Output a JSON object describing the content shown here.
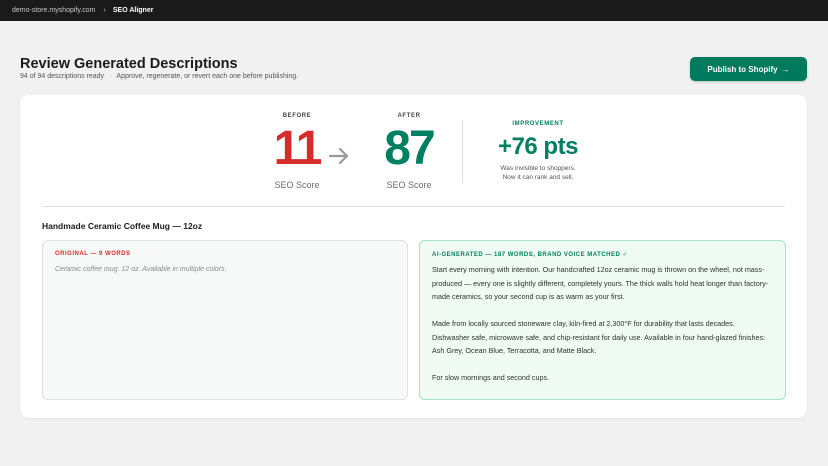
{
  "topbar": {
    "store": "demo-store.myshopify.com",
    "separator": "›",
    "app": "SEO Aligner"
  },
  "header": {
    "title": "Review Generated Descriptions",
    "status": "94 of 94 descriptions ready",
    "separator": "·",
    "instructions": "Approve, regenerate, or revert each one before publishing.",
    "publish_label": "Publish to Shopify",
    "publish_arrow": "→"
  },
  "scores": {
    "before": {
      "label": "BEFORE",
      "value": "11",
      "caption": "SEO Score"
    },
    "after": {
      "label": "AFTER",
      "value": "87",
      "caption": "SEO Score"
    },
    "improvement": {
      "label": "IMPROVEMENT",
      "value": "+76 pts",
      "note_line1": "Was invisible to shoppers.",
      "note_line2": "Now it can rank and sell."
    }
  },
  "product": {
    "title": "Handmade Ceramic Coffee Mug — 12oz",
    "original": {
      "label": "ORIGINAL — 9 WORDS",
      "text": "Ceramic coffee mug. 12 oz. Available in multiple colors."
    },
    "generated": {
      "label": "AI-GENERATED — 187 WORDS, BRAND VOICE MATCHED ✓",
      "paragraphs": [
        "Start every morning with intention. Our handcrafted 12oz ceramic mug is thrown on the wheel, not mass-produced — every one is slightly different, completely yours. The thick walls hold heat longer than factory-made ceramics, so your second cup is as warm as your first.",
        "Made from locally sourced stoneware clay, kiln-fired at 2,300°F for durability that lasts decades. Dishwasher safe, microwave safe, and chip-resistant for daily use. Available in four hand-glazed finishes: Ash Grey, Ocean Blue, Terracotta, and Matte Black.",
        "For slow mornings and second cups."
      ]
    }
  },
  "colors": {
    "accent": "#008060",
    "before": "#d72c2c",
    "topbar": "#1a1a1a",
    "background": "#f1f1f1"
  },
  "icons": {
    "score_arrow": "arrow-right-icon",
    "check": "checkmark-icon"
  }
}
